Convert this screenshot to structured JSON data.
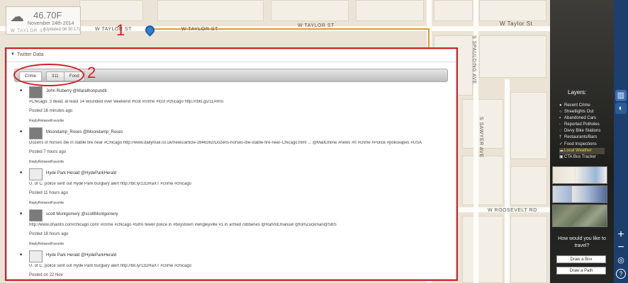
{
  "weather": {
    "icon": "rain-cloud-icon",
    "temperature": "46.70F",
    "date": "November 24th 2014",
    "updated": "(Updated 08:30:17)",
    "location": "W TAYLOR ST"
  },
  "map": {
    "streets": {
      "w_taylor_1": "W TAYLOR ST",
      "w_taylor_2": "W TAYLOR ST",
      "w_taylor_3": "W TAYLOR ST",
      "w_taylor_4": "W Taylor St",
      "w_roosevelt": "W ROOSEVELT RD",
      "s_sawyer": "S SAWYER AVE",
      "s_spaulding": "S SPAULDING AVE"
    },
    "route_color": "#e59a2b"
  },
  "annotations": {
    "one": "1",
    "two": "2",
    "color": "#d11e26"
  },
  "twitter": {
    "title": "Twitter Data",
    "tabs": [
      "Crime",
      "311",
      "Food"
    ],
    "tweets": [
      {
        "handle": "John Ruberry @Marathonpundit",
        "text": "#Chicago: 3 dead, at least 14 wounded over weekend #tcot #crime #tcot #chicago http://rblo.gs/11ARro",
        "time": "Posted 16 minutes ago",
        "actions": "ReplyRetweetFavorite",
        "avatar": "photo"
      },
      {
        "handle": "Moondamp_Roses @Moondamp_Roses",
        "text": "Dozens of horses die in stable fire near #Chicago http://www.dailymail.co.uk/news/article-2846362/Dozens-horses-die-stable-fire-near-Chicago.html ... @MailOnline #news #rt #crime #Police #policeapes #USA",
        "time": "Posted 7 hours ago",
        "actions": "ReplyRetweetFavorite",
        "avatar": "photo"
      },
      {
        "handle": "Hyde Park Herald @HydeParkHerald",
        "text": "U. of C. police sent out Hyde Park burglary alert http://bit.ly/1zDRaXT #crime #chicago",
        "time": "Posted 11 hours ago",
        "actions": "ReplyRetweetFavorite",
        "avatar": "paper"
      },
      {
        "handle": "scott Montgomery @scottMontgomery",
        "text": "http://www.dnainfo.com/chicago.com/   #crime #chicago #58% fewer police in #boystown #wrigleyville #1 in armed robberies @RahmEmanuel @tomZuckman@SBS",
        "time": "Posted 18 hours ago",
        "actions": "ReplyRetweetFavorite",
        "avatar": "photo"
      },
      {
        "handle": "Hyde Park Herald @HydeParkHerald",
        "text": "U. of C. police sent out Hyde Park burglary alert http://bit.ly/1zDRaXT #crime #chicago",
        "time": "Posted on 22 Nov",
        "actions": "ReplyRetweetFavorite",
        "avatar": "paper"
      }
    ]
  },
  "sidebar": {
    "layers_title": "Layers:",
    "layers": [
      {
        "label": "Recent Crime",
        "icon": "pin-icon"
      },
      {
        "label": "Streetlights Out",
        "icon": "bulb-icon"
      },
      {
        "label": "Abandoned Cars",
        "icon": "car-icon"
      },
      {
        "label": "Reported Potholes",
        "icon": "pothole-icon"
      },
      {
        "label": "Divvy Bike Stations",
        "icon": "bike-icon"
      },
      {
        "label": "Restaurants/Bars",
        "icon": "fork-icon"
      },
      {
        "label": "Food Inspections",
        "icon": "check-icon"
      },
      {
        "label": "Local Weather",
        "icon": "cloud-icon",
        "selected": true
      },
      {
        "label": "CTA Bus Tracker",
        "icon": "bus-icon"
      }
    ],
    "travel_question": "How would you like to travel?",
    "draw_box": "Draw a Box",
    "draw_path": "Draw a Path",
    "selected_color": "#f2d04a"
  },
  "toolbar": {
    "chart": "▥",
    "toggle": "◐",
    "zoom_in": "+",
    "zoom_out": "−",
    "locate": "◎",
    "help": "?"
  }
}
